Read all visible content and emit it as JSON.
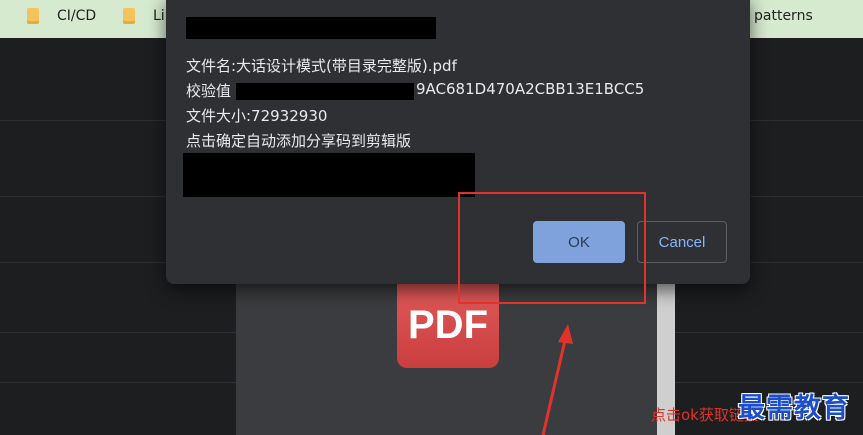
{
  "bookmarks": [
    {
      "label": "CI/CD",
      "icon": "folder-icon"
    },
    {
      "label": "Li",
      "icon": "folder-icon"
    },
    {
      "label": "patterns",
      "icon": "folder-icon"
    }
  ],
  "dialog": {
    "filename": "文件名:大话设计模式(带目录完整版).pdf",
    "checksum_label": "校验值",
    "checksum_value": "9AC681D470A2CBB13E1BCC5",
    "filesize": "文件大小:72932930",
    "instruction": "点击确定自动添加分享码到剪辑版",
    "ok_label": "OK",
    "cancel_label": "Cancel"
  },
  "preview": {
    "label": "PDF"
  },
  "annotation": {
    "hint": "点击ok获取链接",
    "color": "#e1332c"
  },
  "watermark": {
    "text": "最需教育"
  }
}
